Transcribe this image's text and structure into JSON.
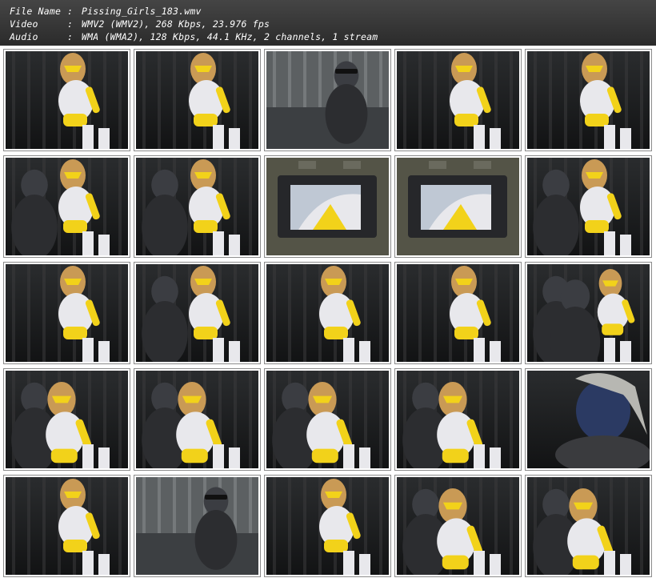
{
  "info": {
    "rows": [
      {
        "label": "File Name",
        "value": "Pissing_Girls_183.wmv"
      },
      {
        "label": "Video",
        "value": "WMV2 (WMV2), 268 Kbps, 23.976 fps"
      },
      {
        "label": "Audio",
        "value": "WMA (WMA2), 128 Kbps, 44.1 KHz, 2 channels, 1 stream"
      }
    ],
    "separator": ":"
  },
  "colors": {
    "header_bg": "#333333",
    "header_text": "#ffffff",
    "frame_border": "#8c8c8c",
    "suit_yellow": "#f2d21a",
    "suit_white": "#e8e8ec",
    "hair": "#c99a55",
    "dark_suit": "#2c2d30",
    "cage": "#3a3b3c"
  },
  "thumbnails": [
    {
      "scene": "masked-face-closeup"
    },
    {
      "scene": "bending-white-suit"
    },
    {
      "scene": "man-in-coat"
    },
    {
      "scene": "bending-side"
    },
    {
      "scene": "masked-face-dark"
    },
    {
      "scene": "villain-and-heroine"
    },
    {
      "scene": "villain-behind-heroine"
    },
    {
      "scene": "monitor-screen"
    },
    {
      "scene": "monitor-screen"
    },
    {
      "scene": "villain-grab"
    },
    {
      "scene": "hair-forward"
    },
    {
      "scene": "villain-and-heroine-cage"
    },
    {
      "scene": "heroine-cage-bend"
    },
    {
      "scene": "heroine-cage-bend"
    },
    {
      "scene": "villain-close"
    },
    {
      "scene": "heroine-floor"
    },
    {
      "scene": "heroine-floor"
    },
    {
      "scene": "heroine-lying"
    },
    {
      "scene": "heroine-lying"
    },
    {
      "scene": "villain-mask-closeup"
    },
    {
      "scene": "heroine-standing"
    },
    {
      "scene": "man-machinery"
    },
    {
      "scene": "heroine-face-up"
    },
    {
      "scene": "heroine-lying-side"
    },
    {
      "scene": "heroine-lying-floor"
    }
  ]
}
